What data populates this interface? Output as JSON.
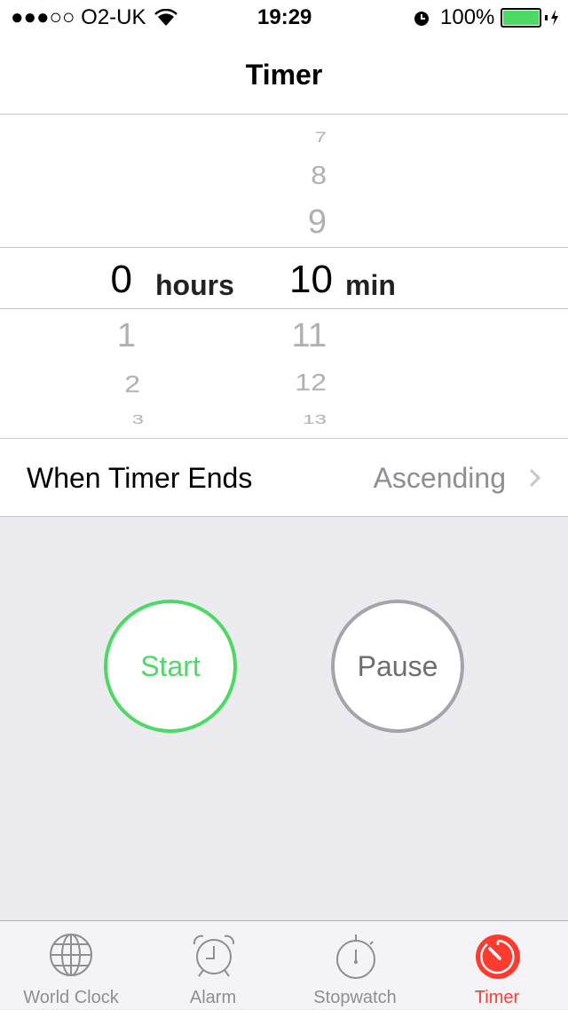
{
  "status": {
    "carrier": "●●●○○ O2-UK",
    "time": "19:29",
    "battery": "100%",
    "signal_bars": 3,
    "battery_level": 1.0
  },
  "nav": {
    "title": "Timer"
  },
  "picker": {
    "hours_above": [],
    "hours_selected": "0",
    "hours_unit": "hours",
    "hours_below": [
      "1",
      "2",
      "3"
    ],
    "minutes_above": [
      "7",
      "8",
      "9"
    ],
    "minutes_selected": "10",
    "minutes_unit": "min",
    "minutes_below": [
      "11",
      "12",
      "13"
    ]
  },
  "when_timer_ends": {
    "label": "When Timer Ends",
    "value": "Ascending"
  },
  "buttons": {
    "start": "Start",
    "pause": "Pause"
  },
  "colors": {
    "start": "#4cd964",
    "pause": "#a4a4aa",
    "accent": "#ff3b30"
  },
  "tabs": [
    {
      "label": "World Clock",
      "icon": "globe-icon"
    },
    {
      "label": "Alarm",
      "icon": "alarm-clock-icon"
    },
    {
      "label": "Stopwatch",
      "icon": "stopwatch-icon"
    },
    {
      "label": "Timer",
      "icon": "timer-icon",
      "active": true
    }
  ]
}
